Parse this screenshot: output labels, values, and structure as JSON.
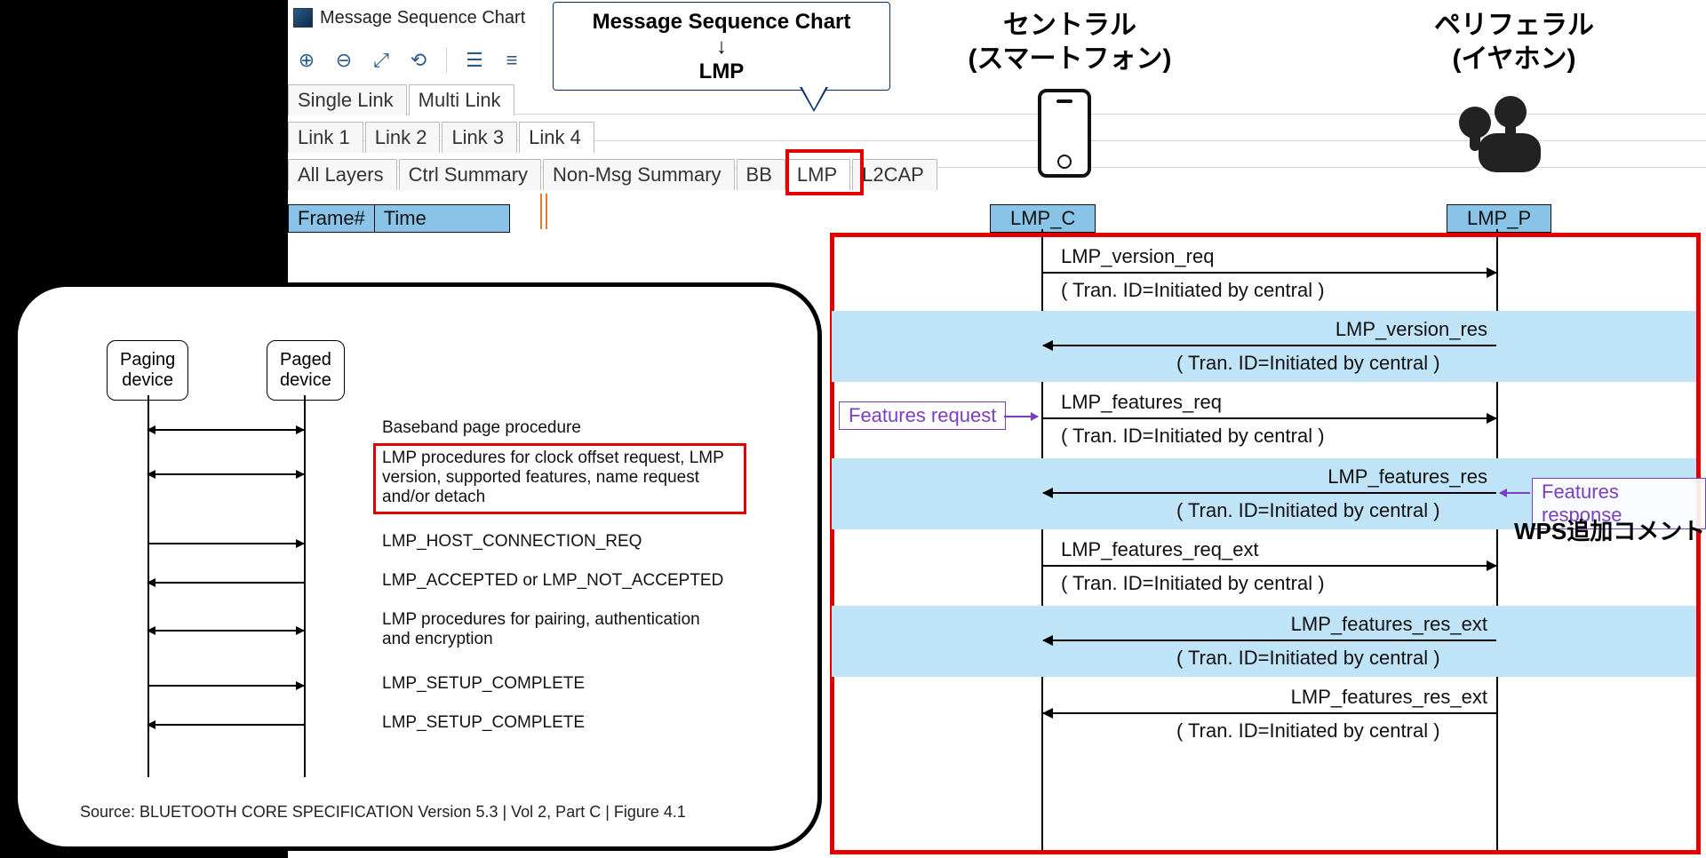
{
  "window": {
    "title": "Message Sequence Chart"
  },
  "callout": {
    "line1": "Message  Sequence Chart",
    "line2": "↓",
    "line3": "LMP"
  },
  "tabs_level1": [
    "Single Link",
    "Multi Link"
  ],
  "tabs_level1_active": 1,
  "tabs_level2": [
    "Link 1",
    "Link 2",
    "Link 3",
    "Link 4"
  ],
  "tabs_level2_active": 3,
  "tabs_level3": [
    "All Layers",
    "Ctrl Summary",
    "Non-Msg Summary",
    "BB",
    "LMP",
    "L2CAP"
  ],
  "tabs_level3_active": 4,
  "frame_headers": [
    "Frame#",
    "Time"
  ],
  "central": {
    "label1": "セントラル",
    "label2": "(スマートフォン)"
  },
  "peripheral": {
    "label1": "ペリフェラル",
    "label2": "(イヤホン)"
  },
  "columns": {
    "c": "LMP_C",
    "p": "LMP_P"
  },
  "annotations": {
    "features_request": "Features request",
    "features_response": "Features response",
    "wps": "WPS追加コメント"
  },
  "messages": [
    {
      "name": "LMP_version_req",
      "sub": "( Tran. ID=Initiated by central )",
      "dir": "r"
    },
    {
      "name": "LMP_version_res",
      "sub": "( Tran. ID=Initiated by central )",
      "dir": "l"
    },
    {
      "name": "LMP_features_req",
      "sub": "( Tran. ID=Initiated by central )",
      "dir": "r"
    },
    {
      "name": "LMP_features_res",
      "sub": "( Tran. ID=Initiated by central )",
      "dir": "l"
    },
    {
      "name": "LMP_features_req_ext",
      "sub": "( Tran. ID=Initiated by central )",
      "dir": "r"
    },
    {
      "name": "LMP_features_res_ext",
      "sub": "( Tran. ID=Initiated by central )",
      "dir": "l"
    },
    {
      "name": "LMP_features_res_ext",
      "sub": "( Tran. ID=Initiated by central )",
      "dir": "l"
    }
  ],
  "spec": {
    "paging": "Paging\ndevice",
    "paged": "Paged\ndevice",
    "rows": [
      {
        "dir": "both",
        "text": "Baseband page procedure"
      },
      {
        "dir": "both",
        "text": "LMP procedures for clock offset request, LMP version, supported features, name request and/or detach",
        "boxed": true
      },
      {
        "dir": "r",
        "text": "LMP_HOST_CONNECTION_REQ"
      },
      {
        "dir": "l",
        "text": "LMP_ACCEPTED or LMP_NOT_ACCEPTED"
      },
      {
        "dir": "both",
        "text": "LMP procedures for pairing, authentication and encryption"
      },
      {
        "dir": "r",
        "text": "LMP_SETUP_COMPLETE"
      },
      {
        "dir": "l",
        "text": "LMP_SETUP_COMPLETE"
      }
    ],
    "source": "Source: BLUETOOTH CORE SPECIFICATION Version 5.3 | Vol 2, Part C | Figure 4.1"
  }
}
